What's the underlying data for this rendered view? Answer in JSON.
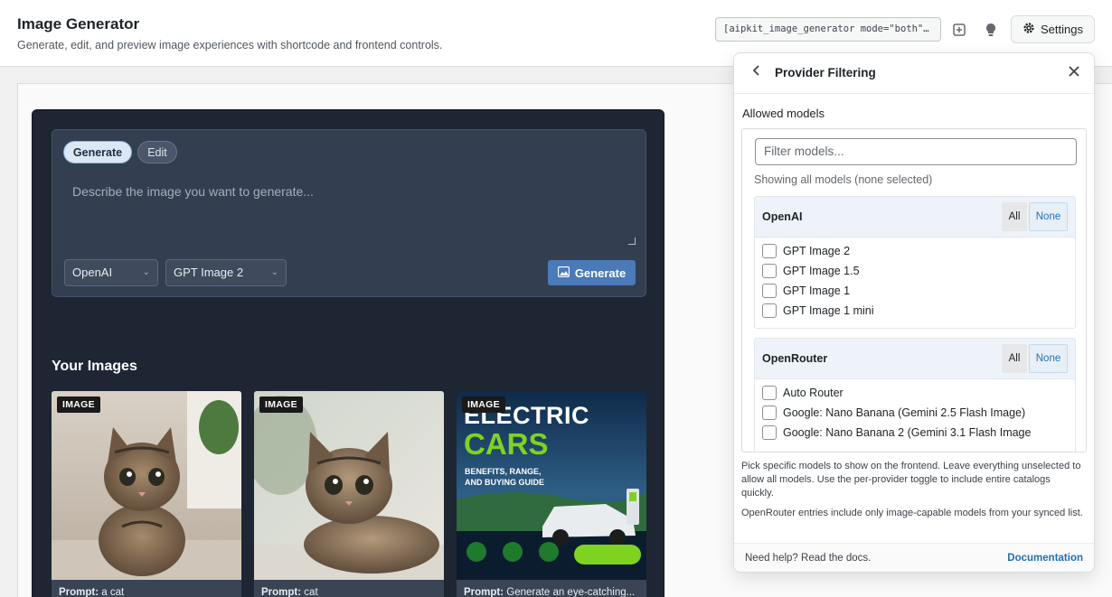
{
  "header": {
    "title": "Image Generator",
    "subtitle": "Generate, edit, and preview image experiences with shortcode and frontend controls.",
    "shortcode": "[aipkit_image_generator mode=\"both\" ...",
    "settings_label": "Settings",
    "icons": [
      "layout-icon",
      "lightbulb-icon",
      "gear-icon"
    ]
  },
  "composer": {
    "tabs": [
      {
        "label": "Generate",
        "active": true
      },
      {
        "label": "Edit",
        "active": false
      }
    ],
    "prompt_placeholder": "Describe the image you want to generate...",
    "provider_select": "OpenAI",
    "model_select": "GPT Image 2",
    "generate_label": "Generate"
  },
  "gallery": {
    "heading": "Your Images",
    "cards": [
      {
        "badge": "IMAGE",
        "prompt_label": "Prompt:",
        "prompt": "a cat"
      },
      {
        "badge": "IMAGE",
        "prompt_label": "Prompt:",
        "prompt": "cat"
      },
      {
        "badge": "IMAGE",
        "prompt_label": "Prompt:",
        "prompt": "Generate an eye-catching..."
      }
    ],
    "poster_text": {
      "line1": "ELECTRIC",
      "line2": "CARS",
      "line3": "BENEFITS, RANGE,",
      "line4": "AND BUYING GUIDE"
    }
  },
  "panel": {
    "title": "Provider Filtering",
    "allowed_label": "Allowed models",
    "filter_placeholder": "Filter models...",
    "showing_text": "Showing all models (none selected)",
    "providers": [
      {
        "name": "OpenAI",
        "all_label": "All",
        "none_label": "None",
        "models": [
          "GPT Image 2",
          "GPT Image 1.5",
          "GPT Image 1",
          "GPT Image 1 mini"
        ]
      },
      {
        "name": "OpenRouter",
        "all_label": "All",
        "none_label": "None",
        "models": [
          "Auto Router",
          "Google: Nano Banana (Gemini 2.5 Flash Image)",
          "Google: Nano Banana 2 (Gemini 3.1 Flash Image"
        ]
      }
    ],
    "help1": "Pick specific models to show on the frontend. Leave everything unselected to allow all models. Use the per-provider toggle to include entire catalogs quickly.",
    "help2": "OpenRouter entries include only image-capable models from your synced list.",
    "footer_help": "Need help? Read the docs.",
    "footer_link": "Documentation"
  },
  "colors": {
    "app_bg": "#1e2634",
    "accent": "#4a7ab8",
    "link": "#2271b1"
  }
}
